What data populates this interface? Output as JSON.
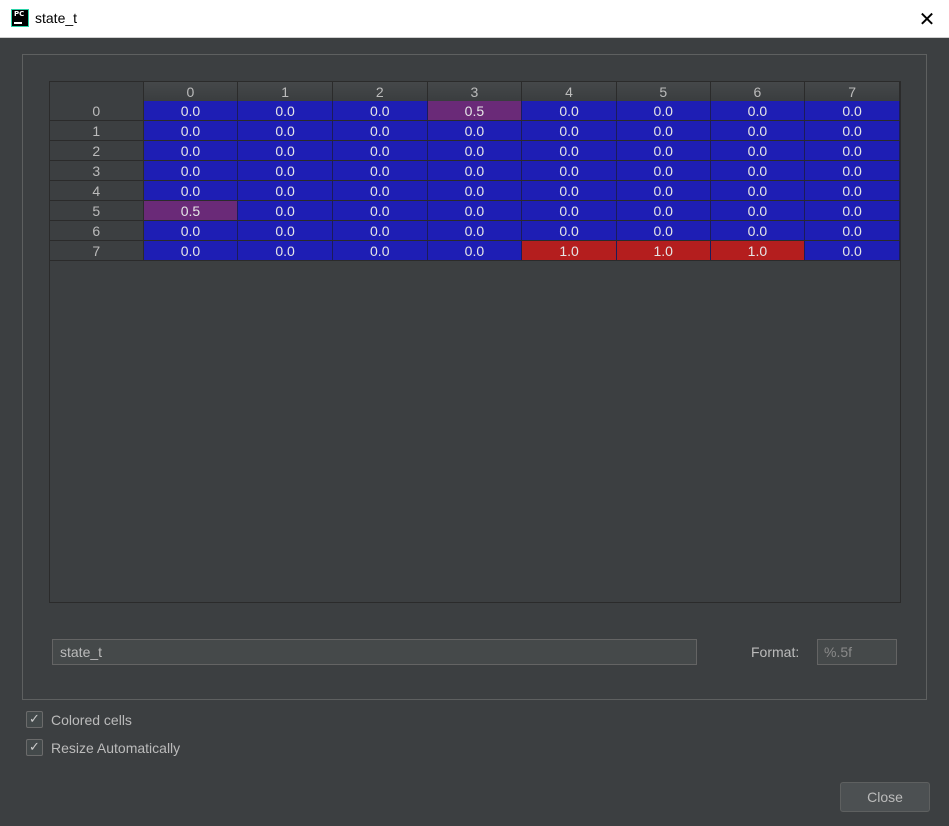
{
  "window": {
    "title": "state_t",
    "app_icon_text": "PC",
    "close_glyph": "✕"
  },
  "grid": {
    "columns": [
      "0",
      "1",
      "2",
      "3",
      "4",
      "5",
      "6",
      "7"
    ],
    "rows": [
      {
        "label": "0",
        "cells": [
          "0.0",
          "0.0",
          "0.0",
          "0.5",
          "0.0",
          "0.0",
          "0.0",
          "0.0"
        ]
      },
      {
        "label": "1",
        "cells": [
          "0.0",
          "0.0",
          "0.0",
          "0.0",
          "0.0",
          "0.0",
          "0.0",
          "0.0"
        ]
      },
      {
        "label": "2",
        "cells": [
          "0.0",
          "0.0",
          "0.0",
          "0.0",
          "0.0",
          "0.0",
          "0.0",
          "0.0"
        ]
      },
      {
        "label": "3",
        "cells": [
          "0.0",
          "0.0",
          "0.0",
          "0.0",
          "0.0",
          "0.0",
          "0.0",
          "0.0"
        ]
      },
      {
        "label": "4",
        "cells": [
          "0.0",
          "0.0",
          "0.0",
          "0.0",
          "0.0",
          "0.0",
          "0.0",
          "0.0"
        ]
      },
      {
        "label": "5",
        "cells": [
          "0.5",
          "0.0",
          "0.0",
          "0.0",
          "0.0",
          "0.0",
          "0.0",
          "0.0"
        ]
      },
      {
        "label": "6",
        "cells": [
          "0.0",
          "0.0",
          "0.0",
          "0.0",
          "0.0",
          "0.0",
          "0.0",
          "0.0"
        ]
      },
      {
        "label": "7",
        "cells": [
          "0.0",
          "0.0",
          "0.0",
          "0.0",
          "1.0",
          "1.0",
          "1.0",
          "0.0"
        ]
      }
    ],
    "colors": {
      "low": "#1e1eb4",
      "mid": "#6a2a78",
      "high": "#b41e1e"
    }
  },
  "expression_field": {
    "value": "state_t"
  },
  "format": {
    "label": "Format:",
    "value": "%.5f"
  },
  "options": {
    "colored_cells": {
      "label": "Colored cells",
      "checked": true
    },
    "resize_automatically": {
      "label": "Resize Automatically",
      "checked": true
    }
  },
  "footer": {
    "close_label": "Close"
  }
}
